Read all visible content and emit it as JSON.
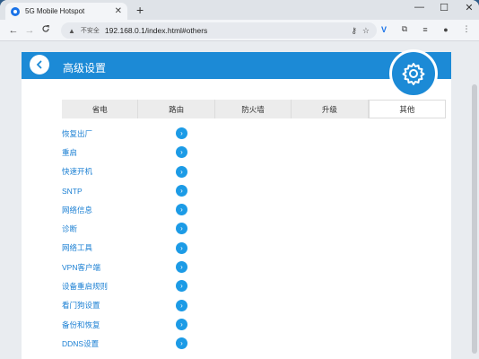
{
  "browser": {
    "tab_title": "5G Mobile Hotspot",
    "tab_close": "✕",
    "new_tab": "+",
    "win_minimize": "—",
    "win_maximize": "☐",
    "win_close": "✕",
    "back": "←",
    "forward": "→",
    "reload": "C",
    "insecure_label": "不安全",
    "url": "192.168.0.1/index.html#others"
  },
  "page": {
    "title": "高级设置",
    "tabs": [
      "省电",
      "路由",
      "防火墙",
      "升级",
      "其他"
    ],
    "active_tab": "其他",
    "menu": [
      "恢复出厂",
      "重启",
      "快速开机",
      "SNTP",
      "网络信息",
      "诊断",
      "网络工具",
      "VPN客户端",
      "设备重启规则",
      "看门狗设置",
      "备份和恢复",
      "DDNS设置"
    ]
  },
  "colors": {
    "accent": "#1c8ad6",
    "link": "#1a7fd3"
  }
}
